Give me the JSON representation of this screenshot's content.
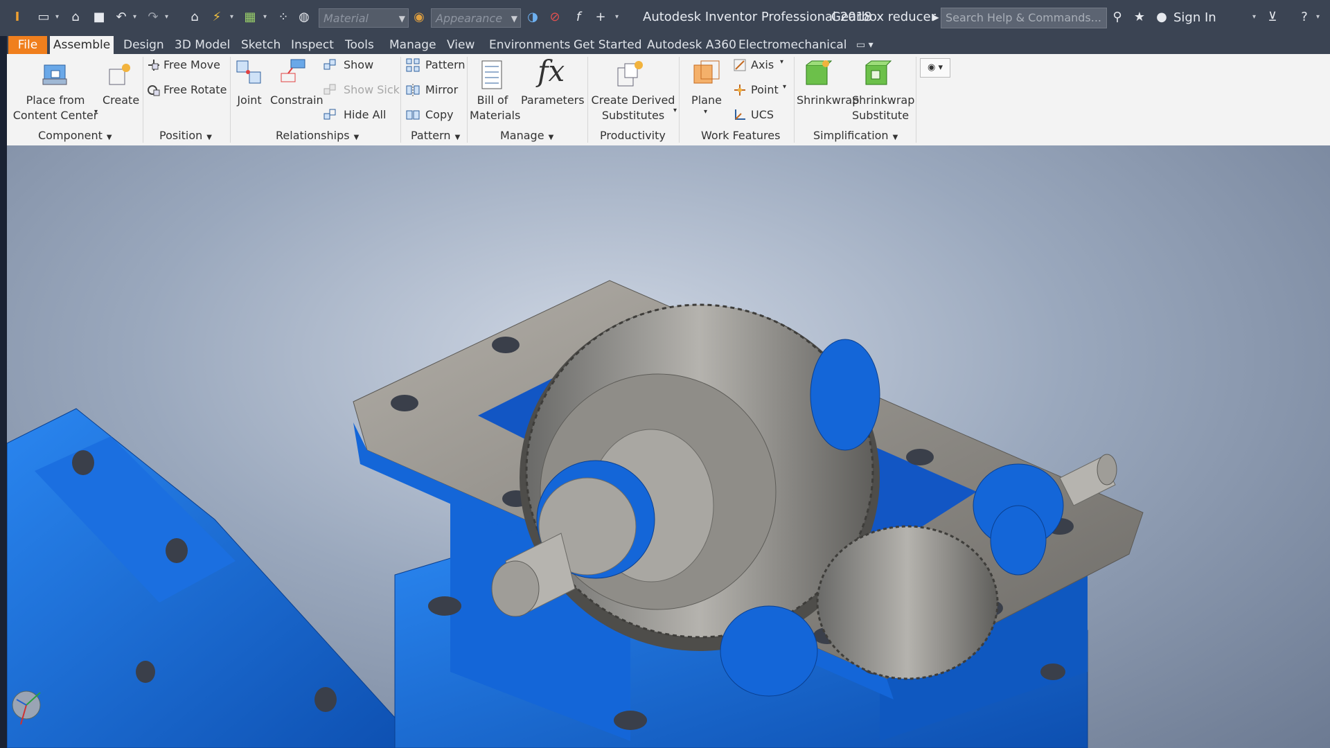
{
  "titlebar": {
    "app_title": "Autodesk Inventor Professional 2018",
    "doc_title": "Gearbox reducer",
    "material_placeholder": "Material",
    "appearance_placeholder": "Appearance",
    "search_placeholder": "Search Help & Commands...",
    "sign_in": "Sign In"
  },
  "tabs": [
    {
      "label": "File"
    },
    {
      "label": "Assemble"
    },
    {
      "label": "Design"
    },
    {
      "label": "3D Model"
    },
    {
      "label": "Sketch"
    },
    {
      "label": "Inspect"
    },
    {
      "label": "Tools"
    },
    {
      "label": "Manage"
    },
    {
      "label": "View"
    },
    {
      "label": "Environments"
    },
    {
      "label": "Get Started"
    },
    {
      "label": "Autodesk A360"
    },
    {
      "label": "Electromechanical"
    }
  ],
  "ribbon": {
    "component": {
      "title": "Component",
      "place_line1": "Place from",
      "place_line2": "Content Center",
      "create": "Create"
    },
    "position": {
      "title": "Position",
      "free_move": "Free Move",
      "free_rotate": "Free Rotate"
    },
    "relationships": {
      "title": "Relationships",
      "joint": "Joint",
      "constrain": "Constrain",
      "show": "Show",
      "show_sick": "Show Sick",
      "hide_all": "Hide All"
    },
    "pattern": {
      "title": "Pattern",
      "pattern": "Pattern",
      "mirror": "Mirror",
      "copy": "Copy"
    },
    "manage": {
      "title": "Manage",
      "bom_line1": "Bill of",
      "bom_line2": "Materials",
      "parameters": "Parameters"
    },
    "productivity": {
      "title": "Productivity",
      "derived_line1": "Create Derived",
      "derived_line2": "Substitutes"
    },
    "work_features": {
      "title": "Work Features",
      "plane": "Plane",
      "axis": "Axis",
      "point": "Point",
      "ucs": "UCS"
    },
    "simplification": {
      "title": "Simplification",
      "shrinkwrap": "Shrinkwrap",
      "sub_line1": "Shrinkwrap",
      "sub_line2": "Substitute"
    }
  },
  "colors": {
    "file_tab": "#f07f1d",
    "titlebar": "#3b4453",
    "ribbon": "#f3f3f3",
    "housing_blue": "#1466d8",
    "gear_gray": "#8c8a85"
  }
}
